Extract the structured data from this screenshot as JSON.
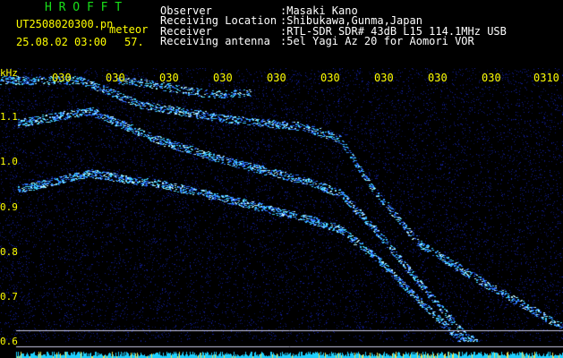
{
  "header": {
    "app_name": "H R O F F T",
    "file_name": "UT2508020300.pn",
    "mode_label": "meteor",
    "datetime": "25.08.02 03:00",
    "count": "57.",
    "fields": [
      {
        "label": "Observer",
        "value": ":Masaki Kano"
      },
      {
        "label": "Receiving Location",
        "value": ":Shibukawa,Gunma,Japan"
      },
      {
        "label": "Receiver",
        "value": ":RTL-SDR SDR# 43dB L15 114.1MHz USB"
      },
      {
        "label": "Receiving antenna",
        "value": ":5el Yagi Az 20 for Aomori VOR"
      }
    ]
  },
  "axes": {
    "y_unit": "kHz",
    "y_ticks": [
      "1.1",
      "1.0",
      "0.9",
      "0.8",
      "0.7",
      "0.6"
    ],
    "x_ticks": [
      "030",
      "030",
      "030",
      "030",
      "030",
      "030",
      "030",
      "030",
      "030",
      "0310"
    ]
  },
  "colors": {
    "background": "#000000",
    "noise": "#1a2aa0",
    "signal": "#3fd0ff",
    "header_text": "#ffffff",
    "title_text": "#19e019",
    "axis_text": "#ffff00",
    "marker_line": "#c8c8e6",
    "baseline": "#1ed0ff"
  }
}
